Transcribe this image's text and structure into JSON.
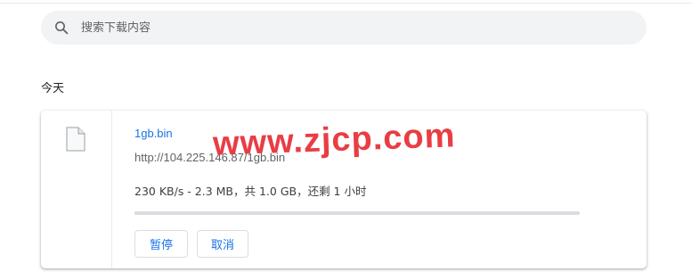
{
  "search": {
    "placeholder": "搜索下载内容",
    "icon": "search-icon"
  },
  "section": {
    "title": "今天"
  },
  "download": {
    "file_icon": "file-icon",
    "file_name": "1gb.bin",
    "url": "http://104.225.146.87/1gb.bin",
    "status": "230 KB/s - 2.3 MB，共 1.0 GB，还剩 1 小时",
    "progress_fraction": 0.0023,
    "pause_label": "暂停",
    "cancel_label": "取消",
    "watermark": "www.zjcp.com"
  },
  "colors": {
    "accent": "#1a73e8",
    "watermark": "#e8333a",
    "search_bg": "#f1f3f4"
  }
}
